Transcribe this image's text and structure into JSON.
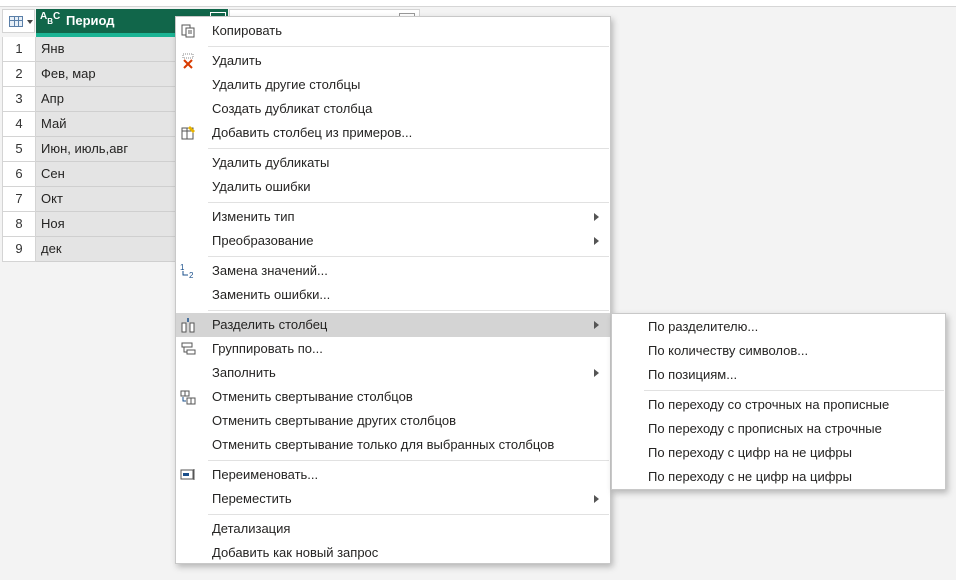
{
  "grid": {
    "column_header": "Период",
    "rows": [
      {
        "num": "1",
        "value": "Янв"
      },
      {
        "num": "2",
        "value": "Фев, мар"
      },
      {
        "num": "3",
        "value": "Апр"
      },
      {
        "num": "4",
        "value": "Май"
      },
      {
        "num": "5",
        "value": "Июн, июль,авг"
      },
      {
        "num": "6",
        "value": "Сен"
      },
      {
        "num": "7",
        "value": "Окт"
      },
      {
        "num": "8",
        "value": "Ноя"
      },
      {
        "num": "9",
        "value": "дек"
      }
    ]
  },
  "menu": {
    "items": [
      {
        "label": "Копировать",
        "icon": "copy-icon"
      },
      {
        "label": "Удалить",
        "icon": "delete-icon"
      },
      {
        "label": "Удалить другие столбцы"
      },
      {
        "label": "Создать дубликат столбца"
      },
      {
        "label": "Добавить столбец из примеров...",
        "icon": "column-from-examples-icon"
      },
      {
        "label": "Удалить дубликаты"
      },
      {
        "label": "Удалить ошибки"
      },
      {
        "label": "Изменить тип",
        "submenu": true
      },
      {
        "label": "Преобразование",
        "submenu": true
      },
      {
        "label": "Замена значений...",
        "icon": "replace-values-icon"
      },
      {
        "label": "Заменить ошибки..."
      },
      {
        "label": "Разделить столбец",
        "icon": "split-column-icon",
        "submenu": true,
        "highlighted": true
      },
      {
        "label": "Группировать по...",
        "icon": "group-by-icon"
      },
      {
        "label": "Заполнить",
        "submenu": true
      },
      {
        "label": "Отменить свертывание столбцов",
        "icon": "unpivot-icon"
      },
      {
        "label": "Отменить свертывание других столбцов"
      },
      {
        "label": "Отменить свертывание только для выбранных столбцов"
      },
      {
        "label": "Переименовать...",
        "icon": "rename-icon"
      },
      {
        "label": "Переместить",
        "submenu": true
      },
      {
        "label": "Детализация"
      },
      {
        "label": "Добавить как новый запрос"
      }
    ]
  },
  "submenu": {
    "items": [
      {
        "label": "По разделителю..."
      },
      {
        "label": "По количеству символов..."
      },
      {
        "label": "По позициям..."
      },
      {
        "label": "По переходу со строчных на прописные"
      },
      {
        "label": "По переходу с прописных на строчные"
      },
      {
        "label": "По переходу с цифр на не цифры"
      },
      {
        "label": "По переходу с не цифр на цифры"
      }
    ]
  },
  "colors": {
    "header_bg": "#11664a",
    "header_accent": "#1bb494",
    "menu_highlight": "#d4d4d4"
  }
}
